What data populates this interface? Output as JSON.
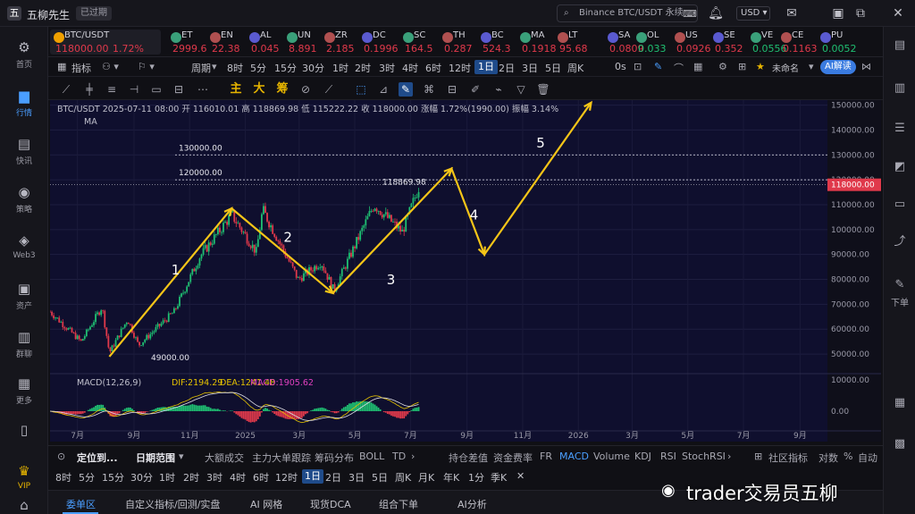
{
  "app": {
    "name": "五柳先生",
    "expired_badge": "已过期",
    "logo": "五"
  },
  "titlebar": {
    "search_placeholder": "Binance BTC/USDT 永续",
    "currency": "USD",
    "icons": [
      "bell-icon",
      "mail-icon",
      "minimize-icon",
      "restore-icon",
      "close-icon"
    ]
  },
  "sidebar": {
    "items": [
      {
        "label": "首页",
        "icon": "home-icon"
      },
      {
        "label": "行情",
        "icon": "market-icon",
        "active": true
      },
      {
        "label": "快讯",
        "icon": "news-icon"
      },
      {
        "label": "策略",
        "icon": "robot-icon"
      },
      {
        "label": "Web3",
        "icon": "web3-icon"
      },
      {
        "label": "资产",
        "icon": "wallet-icon"
      },
      {
        "label": "群聊",
        "icon": "chat-icon"
      },
      {
        "label": "更多",
        "icon": "grid-icon"
      },
      {
        "label": "",
        "icon": "phone-icon"
      },
      {
        "label": "VIP",
        "icon": "vip-icon"
      }
    ]
  },
  "ticker": [
    {
      "sym": "BTC/USDT",
      "price": "118000.00",
      "chg": "1.72%",
      "dir": "up",
      "active": true
    },
    {
      "sym": "ET",
      "price": "2999.6",
      "dir": "up"
    },
    {
      "sym": "EN",
      "price": "22.38",
      "dir": "up"
    },
    {
      "sym": "AL",
      "price": "0.045",
      "dir": "up"
    },
    {
      "sym": "UN",
      "price": "8.891",
      "dir": "up"
    },
    {
      "sym": "ZR",
      "price": "2.185",
      "dir": "up"
    },
    {
      "sym": "DC",
      "price": "0.1996",
      "dir": "up"
    },
    {
      "sym": "SC",
      "price": "164.5",
      "dir": "up"
    },
    {
      "sym": "TH",
      "price": "0.287",
      "dir": "up"
    },
    {
      "sym": "BC",
      "price": "524.3",
      "dir": "up"
    },
    {
      "sym": "MA",
      "price": "0.1918",
      "dir": "up"
    },
    {
      "sym": "LT",
      "price": "95.68",
      "dir": "up"
    },
    {
      "sym": "SA",
      "price": "0.0809",
      "dir": "up"
    },
    {
      "sym": "OL",
      "price": "0.033",
      "dir": "dn"
    },
    {
      "sym": "US",
      "price": "0.0926",
      "dir": "up"
    },
    {
      "sym": "SE",
      "price": "0.352",
      "dir": "up"
    },
    {
      "sym": "VE",
      "price": "0.0556",
      "dir": "dn"
    },
    {
      "sym": "CE",
      "price": "0.1163",
      "dir": "up"
    },
    {
      "sym": "PU",
      "price": "0.0052",
      "dir": "dn"
    }
  ],
  "toolbar1": {
    "indicator": "指标",
    "period": "周期",
    "intervals": [
      "8时",
      "5分",
      "15分",
      "30分",
      "1时",
      "2时",
      "3时",
      "4时",
      "6时",
      "12时",
      "1日",
      "2日",
      "3日",
      "5日",
      "周K"
    ],
    "selected": "1日",
    "right_count": "0s",
    "unnamed": "未命名",
    "ai": "AI解读"
  },
  "toolbar2": {
    "gold_labels": [
      "主",
      "大",
      "筹"
    ]
  },
  "chart": {
    "legend": "BTC/USDT  2025-07-11 08:00  开 116010.01  高 118869.98  低 115222.22  收 118000.00  涨幅 1.72%(1990.00)  振幅 3.14%",
    "ma_label": "MA",
    "macd_label": "MACD(12,26,9)",
    "dif": "DIF:2194.29",
    "dea": "DEA:1241.48",
    "macd": "MACD:1905.62",
    "price_axis": [
      "150000.00",
      "140000.00",
      "130000.00",
      "120000.00",
      "110000.00",
      "100000.00",
      "90000.00",
      "80000.00",
      "70000.00",
      "60000.00",
      "50000.00"
    ],
    "macd_axis": [
      "10000.00",
      "0.00"
    ],
    "time_axis": [
      "7月",
      "9月",
      "11月",
      "2025",
      "3月",
      "5月",
      "7月",
      "9月",
      "11月",
      "2026",
      "3月",
      "5月",
      "7月",
      "9月"
    ],
    "annotations": {
      "h130": "130000.00",
      "h120": "120000.00",
      "last": "118869.98",
      "low": "49000.00"
    },
    "wave_labels": [
      "1",
      "2",
      "3",
      "4",
      "5"
    ],
    "price_tag": "118000.00"
  },
  "chart_data": {
    "type": "candlestick",
    "ylim": [
      45000,
      152000
    ],
    "levels": [
      130000,
      120000
    ],
    "wave_path": [
      {
        "date": "2024-08-05",
        "price": 49000
      },
      {
        "date": "2024-12-17",
        "price": 108500
      },
      {
        "date": "2025-04-07",
        "price": 74500
      },
      {
        "date": "2025-08-15",
        "price": 124500
      },
      {
        "date": "2025-09-20",
        "price": 90000
      },
      {
        "date": "2026-01-15",
        "price": 151000
      }
    ]
  },
  "footer1": {
    "locate": "定位到...",
    "range": "日期范围",
    "tags": [
      "大额成交",
      "主力大单跟踪",
      "筹码分布",
      "BOLL",
      "TD"
    ],
    "right": [
      "持仓差值",
      "资金费率",
      "FR",
      "MACD",
      "Volume",
      "KDJ",
      "RSI",
      "StochRSI"
    ],
    "community": "社区指标",
    "log": "对数",
    "pct": "%",
    "auto": "自动"
  },
  "footer2": {
    "intervals": [
      "8时",
      "5分",
      "15分",
      "30分",
      "1时",
      "2时",
      "3时",
      "4时",
      "6时",
      "12时",
      "1日",
      "2日",
      "3日",
      "5日",
      "周K",
      "月K",
      "年K",
      "1分",
      "季K"
    ],
    "selected": "1日"
  },
  "bottomtabs": [
    "委单区",
    "自定义指标/回测/实盘",
    "AI 网格",
    "现货DCA",
    "组合下单",
    "AI分析"
  ],
  "watermark": "trader交易员五柳",
  "rightbar": {
    "label": "下单"
  }
}
